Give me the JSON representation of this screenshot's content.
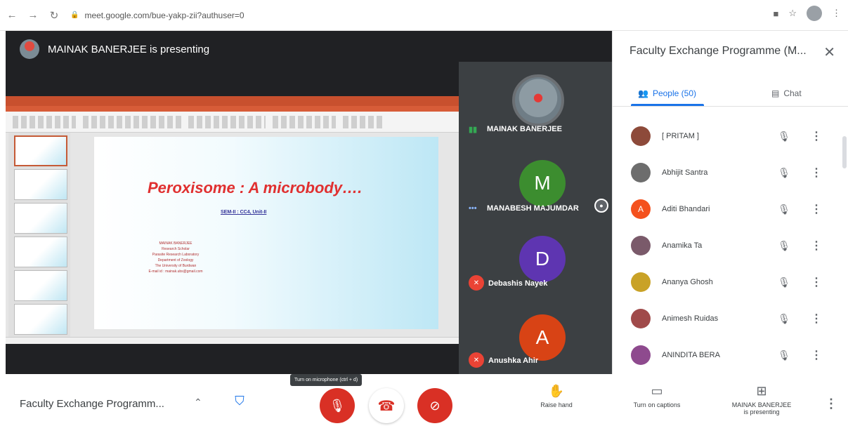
{
  "browser": {
    "url": "meet.google.com/bue-yakp-zii?authuser=0"
  },
  "stage": {
    "presenter_banner": "MAINAK BANERJEE is presenting"
  },
  "slide": {
    "title": "Peroxisome : A microbody….",
    "subtitle": "SEM-II : CC4, Unit-II",
    "author_lines": [
      "MAINAK BANERJEE",
      "Research Scholar",
      "Parasite Research Laboratory",
      "Department of Zoology",
      "The University of Burdwan",
      "E-mail id : mainak.ubs@gmail.com"
    ]
  },
  "tiles": [
    {
      "name": "MAINAK BANERJEE",
      "avatar_type": "photo",
      "speaking": true
    },
    {
      "name": "MANABESH MAJUMDAR",
      "avatar_letter": "M",
      "avatar_color": "#3c8d2f",
      "status": "dots"
    },
    {
      "name": "Debashis Nayek",
      "avatar_letter": "D",
      "avatar_color": "#5e35b1",
      "muted": true
    },
    {
      "name": "Anushka Ahir",
      "avatar_letter": "A",
      "avatar_color": "#d84315",
      "muted": true
    }
  ],
  "panel": {
    "title": "Faculty Exchange Programme (M...",
    "tab_people": "People (50)",
    "tab_chat": "Chat",
    "people": [
      {
        "name": "[ PRITAM ]",
        "avatar": "photo",
        "avatar_color": "#8d4a3a"
      },
      {
        "name": "Abhijit Santra",
        "avatar": "photo",
        "avatar_color": "#6d6d6d"
      },
      {
        "name": "Aditi Bhandari",
        "avatar": "letter",
        "letter": "A",
        "avatar_color": "#f4511e"
      },
      {
        "name": "Anamika Ta",
        "avatar": "photo",
        "avatar_color": "#7a5a6a"
      },
      {
        "name": "Ananya Ghosh",
        "avatar": "photo",
        "avatar_color": "#c9a227"
      },
      {
        "name": "Animesh Ruidas",
        "avatar": "photo",
        "avatar_color": "#a04a4a"
      },
      {
        "name": "ANINDITA BERA",
        "avatar": "photo",
        "avatar_color": "#8e4a8e"
      }
    ]
  },
  "bottom": {
    "meeting_name": "Faculty Exchange Programm...",
    "tooltip": "Turn on microphone (ctrl + d)",
    "raise_hand": "Raise hand",
    "captions": "Turn on captions",
    "presenting_line1": "MAINAK BANERJEE",
    "presenting_line2": "is presenting"
  },
  "colors": {
    "accent": "#1a73e8",
    "danger": "#d93025",
    "stage_bg": "#202124",
    "tile_bg": "#3c4043"
  }
}
